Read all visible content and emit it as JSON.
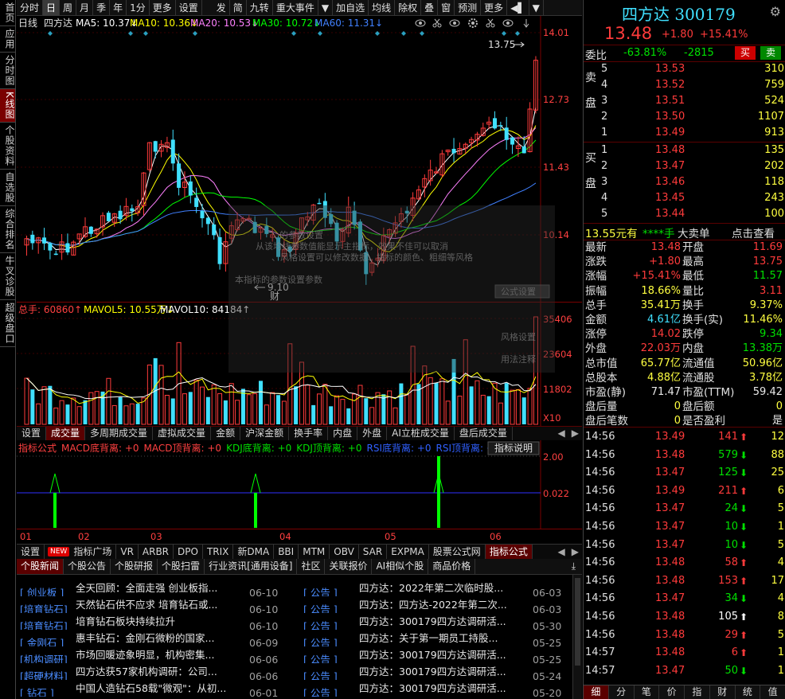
{
  "leftnav": [
    "首页",
    "应用",
    "分时图",
    "K线图",
    "个股资料",
    "自选股",
    "综合排名",
    "牛叉诊股",
    "超级盘口"
  ],
  "topbar": [
    "分时",
    "日",
    "周",
    "月",
    "季",
    "年",
    "1分",
    "更多",
    "设置",
    "发",
    "简",
    "九转",
    "重大事件",
    "▼",
    "加自选",
    "均线",
    "除权",
    "叠",
    "窗",
    "预测",
    "更多",
    "◀▌",
    "▼"
  ],
  "chart": {
    "label": "日线",
    "name": "四方达",
    "ma5": "MA5: 10.37↓",
    "ma10": "MA10: 10.36↓",
    "ma20": "MA20: 10.53↓",
    "ma30": "MA30: 10.72↓",
    "ma60": "MA60: 11.31↓",
    "yticks": [
      "14.01",
      "12.73",
      "11.43",
      "10.14"
    ],
    "high_label": "13.75",
    "low_label": "9.10",
    "cai_label": "财",
    "overlay_lines": [
      "的参数设置",
      "从该均线参数值能显示主指标，效果不佳可以取消",
      "、风格设置可以修改数据、指标的颜色、粗细等风格",
      "本指标的参数设置参数"
    ],
    "overlay_btns": [
      "公式设置",
      "风格设置",
      "用法注释"
    ]
  },
  "vol": {
    "title": "总手: 60860↑",
    "mavol5": "MAVOL5: 10.55万↓",
    "mavol10": "MAVOL10: 84184↑",
    "yticks": [
      "35406",
      "23604",
      "11802"
    ],
    "unit": "X10"
  },
  "tabs1": [
    "设置",
    "成交量",
    "多周期成交量",
    "虚拟成交量",
    "金额",
    "沪深金额",
    "换手率",
    "内盘",
    "外盘",
    "AI立桩成交量",
    "盘后成交量"
  ],
  "ind": {
    "title": "指标公式",
    "items": [
      {
        "t": "MACD底背离: +0",
        "c": "#ff4040"
      },
      {
        "t": "MACD顶背离: +0",
        "c": "#ff4040"
      },
      {
        "t": "KDJ底背离: +0",
        "c": "#00e000"
      },
      {
        "t": "KDJ顶背离: +0",
        "c": "#00e000"
      },
      {
        "t": "RSI底背离: +0",
        "c": "#3060ff"
      },
      {
        "t": "RSI顶背离: +0",
        "c": "#3060ff"
      }
    ],
    "btn": "指标说明",
    "yticks": [
      "2.00",
      "0.022"
    ]
  },
  "months": [
    "01",
    "02",
    "03",
    "04",
    "05",
    "06"
  ],
  "tabs2": [
    "设置",
    "NEW",
    "指标广场",
    "VR",
    "ARBR",
    "DPO",
    "TRIX",
    "新DMA",
    "BBI",
    "MTM",
    "OBV",
    "SAR",
    "EXPMA",
    "股票公式网",
    "指标公式"
  ],
  "newstabs": [
    "个股新闻",
    "个股公告",
    "个股研报",
    "个股扫雷",
    "行业资讯[通用设备]",
    "社区",
    "关联报价",
    "AI相似个股",
    "商品价格"
  ],
  "news_left": [
    {
      "cat": "[ 创业板 ]",
      "title": "全天回顾：全面走强 创业板指...",
      "date": "06-10"
    },
    {
      "cat": "[培育钻石]",
      "title": "天然钻石供不应求 培育钻石或...",
      "date": "06-10"
    },
    {
      "cat": "[培育钻石]",
      "title": "培育钻石板块持续拉升",
      "date": "06-10"
    },
    {
      "cat": "[ 金刚石 ]",
      "title": "惠丰钻石：金刚石微粉的国家...",
      "date": "06-09"
    },
    {
      "cat": "[机构调研]",
      "title": "市场回暖迹象明显，机构密集...",
      "date": "06-06"
    },
    {
      "cat": "[超硬材料]",
      "title": "四方达获57家机构调研：公司...",
      "date": "06-06"
    },
    {
      "cat": "[  钻石  ]",
      "title": "中国人造钻石58载\"微观\"：从初...",
      "date": "06-01"
    }
  ],
  "news_right": [
    {
      "cat": "[  公告  ]",
      "title": "四方达：2022年第二次临时股...",
      "date": "06-03"
    },
    {
      "cat": "[  公告  ]",
      "title": "四方达：四方达-2022年第二次...",
      "date": "06-03"
    },
    {
      "cat": "[  公告  ]",
      "title": "四方达：300179四方达调研活...",
      "date": "05-30"
    },
    {
      "cat": "[  公告  ]",
      "title": "四方达：关于第一期员工持股...",
      "date": "05-25"
    },
    {
      "cat": "[  公告  ]",
      "title": "四方达：300179四方达调研活...",
      "date": "05-25"
    },
    {
      "cat": "[  公告  ]",
      "title": "四方达：300179四方达调研活...",
      "date": "05-24"
    },
    {
      "cat": "[  公告  ]",
      "title": "四方达：300179四方达调研活...",
      "date": "05-20"
    }
  ],
  "quote": {
    "name": "四方达 300179",
    "price": "13.48",
    "change": "+1.80",
    "pct": "+15.41%",
    "weibi_label": "委比",
    "weibi": "-63.81%",
    "weicha": "-2815",
    "buy_btn": "买",
    "sell_btn": "卖",
    "sell_side_label": "卖盘",
    "buy_side_label": "买盘",
    "asks": [
      {
        "lvl": "5",
        "p": "13.53",
        "v": "310"
      },
      {
        "lvl": "4",
        "p": "13.52",
        "v": "759"
      },
      {
        "lvl": "3",
        "p": "13.51",
        "v": "524"
      },
      {
        "lvl": "2",
        "p": "13.50",
        "v": "1107"
      },
      {
        "lvl": "1",
        "p": "13.49",
        "v": "913"
      }
    ],
    "bids": [
      {
        "lvl": "1",
        "p": "13.48",
        "v": "135"
      },
      {
        "lvl": "2",
        "p": "13.47",
        "v": "202"
      },
      {
        "lvl": "3",
        "p": "13.46",
        "v": "118"
      },
      {
        "lvl": "4",
        "p": "13.45",
        "v": "243"
      },
      {
        "lvl": "5",
        "p": "13.44",
        "v": "100"
      }
    ],
    "bigorder": {
      "a": "13.55元有",
      "b": "****手",
      "c": "大卖单",
      "d": "点击查看"
    },
    "stats": [
      {
        "l1": "最新",
        "v1": "13.48",
        "c1": "red",
        "l2": "开盘",
        "v2": "11.69",
        "c2": "red"
      },
      {
        "l1": "涨跌",
        "v1": "+1.80",
        "c1": "red",
        "l2": "最高",
        "v2": "13.75",
        "c2": "red"
      },
      {
        "l1": "涨幅",
        "v1": "+15.41%",
        "c1": "red",
        "l2": "最低",
        "v2": "11.57",
        "c2": "green"
      },
      {
        "l1": "振幅",
        "v1": "18.66%",
        "c1": "yellow",
        "l2": "量比",
        "v2": "3.11",
        "c2": "red"
      },
      {
        "l1": "总手",
        "v1": "35.41万",
        "c1": "yellow",
        "l2": "换手",
        "v2": "9.37%",
        "c2": "yellow"
      },
      {
        "l1": "金额",
        "v1": "4.61亿",
        "c1": "cyan",
        "l2": "换手(实)",
        "v2": "11.46%",
        "c2": "yellow"
      },
      {
        "l1": "涨停",
        "v1": "14.02",
        "c1": "red",
        "l2": "跌停",
        "v2": "9.34",
        "c2": "green"
      },
      {
        "l1": "外盘",
        "v1": "22.03万",
        "c1": "red",
        "l2": "内盘",
        "v2": "13.38万",
        "c2": "green"
      },
      {
        "l1": "总市值",
        "v1": "65.77亿",
        "c1": "yellow",
        "l2": "流通值",
        "v2": "50.96亿",
        "c2": "yellow"
      },
      {
        "l1": "总股本",
        "v1": "4.88亿",
        "c1": "yellow",
        "l2": "流通股",
        "v2": "3.78亿",
        "c2": "yellow"
      },
      {
        "l1": "市盈(静)",
        "v1": "71.47",
        "c1": "white",
        "l2": "市盈(TTM)",
        "v2": "59.42",
        "c2": "white"
      },
      {
        "l1": "盘后量",
        "v1": "0",
        "c1": "yellow",
        "l2": "盘后额",
        "v2": "0",
        "c2": "yellow"
      },
      {
        "l1": "盘后笔数",
        "v1": "0",
        "c1": "yellow",
        "l2": "是否盈利",
        "v2": "是",
        "c2": "white"
      }
    ],
    "ticks": [
      {
        "t": "14:56",
        "p": "13.49",
        "v": "141",
        "d": "up",
        "n": "12"
      },
      {
        "t": "14:56",
        "p": "13.48",
        "v": "579",
        "d": "down",
        "n": "88"
      },
      {
        "t": "14:56",
        "p": "13.47",
        "v": "125",
        "d": "down",
        "n": "25"
      },
      {
        "t": "14:56",
        "p": "13.49",
        "v": "211",
        "d": "up",
        "n": "6"
      },
      {
        "t": "14:56",
        "p": "13.47",
        "v": "24",
        "d": "down",
        "n": "5"
      },
      {
        "t": "14:56",
        "p": "13.47",
        "v": "10",
        "d": "down",
        "n": "1"
      },
      {
        "t": "14:56",
        "p": "13.47",
        "v": "10",
        "d": "down",
        "n": "5"
      },
      {
        "t": "14:56",
        "p": "13.48",
        "v": "58",
        "d": "up",
        "n": "4"
      },
      {
        "t": "14:56",
        "p": "13.48",
        "v": "153",
        "d": "up",
        "n": "17"
      },
      {
        "t": "14:56",
        "p": "13.47",
        "v": "34",
        "d": "down",
        "n": "4"
      },
      {
        "t": "14:56",
        "p": "13.48",
        "v": "105",
        "d": "neutral",
        "n": "8"
      },
      {
        "t": "14:56",
        "p": "13.48",
        "v": "29",
        "d": "up",
        "n": "5"
      },
      {
        "t": "14:57",
        "p": "13.48",
        "v": "6",
        "d": "up",
        "n": "1"
      },
      {
        "t": "14:57",
        "p": "13.47",
        "v": "50",
        "d": "down",
        "n": "1"
      }
    ],
    "bottomtabs": [
      "细",
      "分",
      "笔",
      "价",
      "指",
      "财",
      "统",
      "值"
    ]
  },
  "colors": {
    "up": "#ff3b3b",
    "down": "#40e0ff",
    "ma5": "#ffffff",
    "ma10": "#ffff00",
    "ma20": "#ff80ff",
    "ma30": "#00ff00",
    "ma60": "#4080ff"
  },
  "icons": [
    "eye-icon",
    "scissors-icon",
    "gear-icon",
    "down-arrow-icon"
  ]
}
